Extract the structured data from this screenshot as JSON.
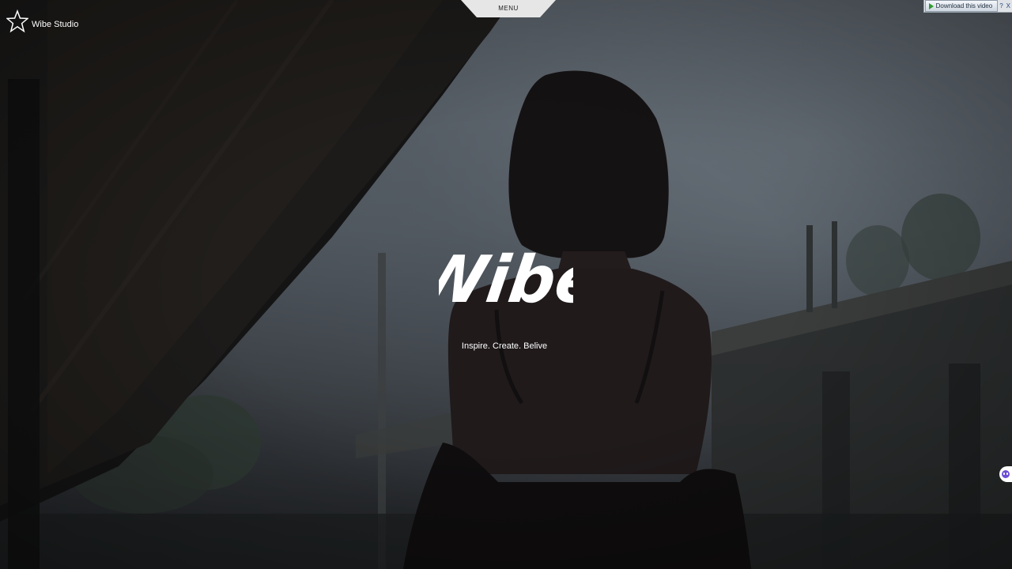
{
  "brand": {
    "name": "Wibe Studio",
    "logo_icon": "star-outline-icon"
  },
  "menu": {
    "label": "MENU"
  },
  "hero": {
    "title": "Wibe",
    "tagline": "Inspire. Create. Belive"
  },
  "download_bar": {
    "label": "Download this video",
    "help_label": "?",
    "close_label": "X"
  },
  "side_widget": {
    "icon": "chat-bot-icon"
  },
  "colors": {
    "text": "#ffffff",
    "menu_tab_bg": "#e6e6e6",
    "menu_text": "#222222"
  }
}
